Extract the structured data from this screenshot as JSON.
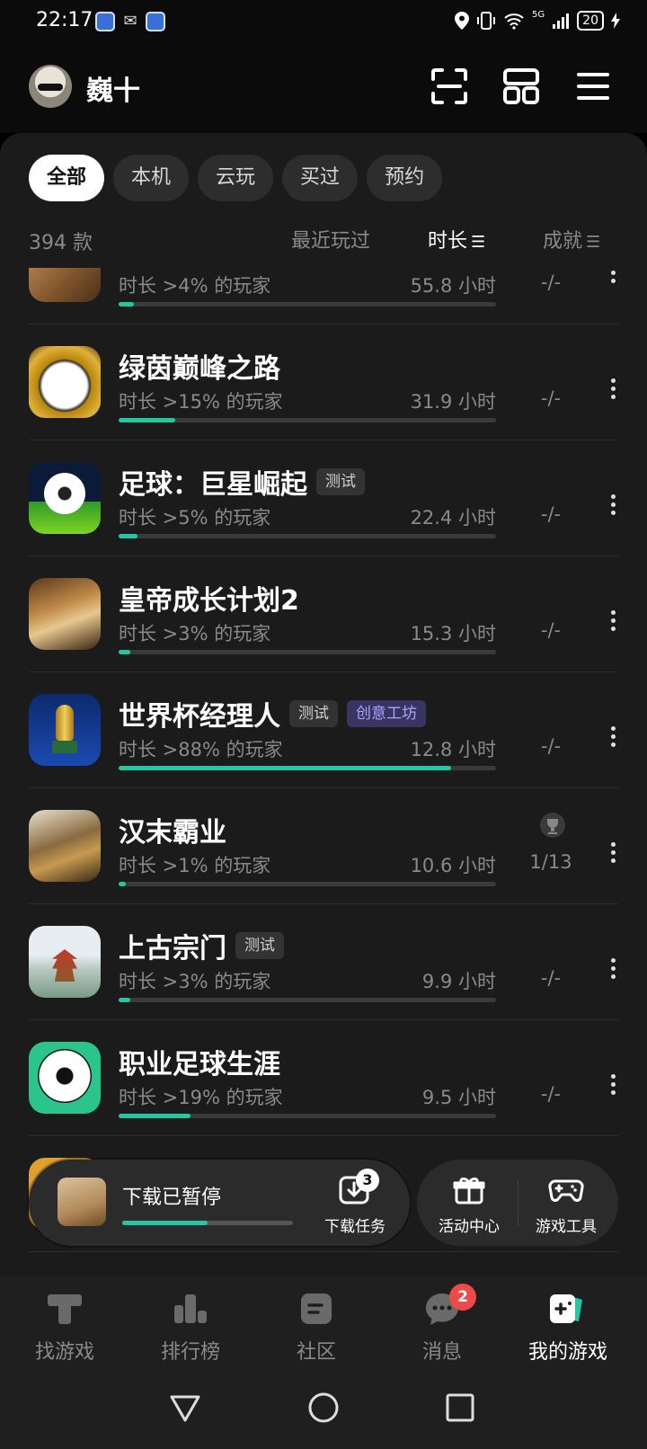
{
  "status_bar": {
    "time": "22:17",
    "network": "5G",
    "battery": "20"
  },
  "header": {
    "username": "巍十"
  },
  "tabs": [
    {
      "label": "全部",
      "active": true
    },
    {
      "label": "本机",
      "active": false
    },
    {
      "label": "云玩",
      "active": false
    },
    {
      "label": "买过",
      "active": false
    },
    {
      "label": "预约",
      "active": false
    }
  ],
  "sortbar": {
    "count": "394 款",
    "recent": "最近玩过",
    "duration": "时长",
    "achievement": "成就"
  },
  "games": [
    {
      "name": "",
      "badges": [],
      "percentile": "时长 >4% 的玩家",
      "hours": "55.8 小时",
      "progress": 0.04,
      "achievement": "-/-",
      "icon": "bronze-mask-icon"
    },
    {
      "name": "绿茵巅峰之路",
      "badges": [],
      "percentile": "时长 >15% 的玩家",
      "hours": "31.9 小时",
      "progress": 0.15,
      "achievement": "-/-",
      "icon": "gold-football-icon"
    },
    {
      "name": "足球：巨星崛起",
      "badges": [
        {
          "text": "测试",
          "style": "gray"
        }
      ],
      "percentile": "时长 >5% 的玩家",
      "hours": "22.4 小时",
      "progress": 0.05,
      "achievement": "-/-",
      "icon": "football-pitch-icon"
    },
    {
      "name": "皇帝成长计划2",
      "badges": [],
      "percentile": "时长 >3% 的玩家",
      "hours": "15.3 小时",
      "progress": 0.03,
      "achievement": "-/-",
      "icon": "emperor-portrait-icon"
    },
    {
      "name": "世界杯经理人",
      "badges": [
        {
          "text": "测试",
          "style": "gray"
        },
        {
          "text": "创意工坊",
          "style": "purple"
        }
      ],
      "percentile": "时长 >88% 的玩家",
      "hours": "12.8 小时",
      "progress": 0.88,
      "achievement": "-/-",
      "icon": "world-cup-trophy-icon"
    },
    {
      "name": "汉末霸业",
      "badges": [],
      "percentile": "时长 >1% 的玩家",
      "hours": "10.6 小时",
      "progress": 0.01,
      "achievement": "1/13",
      "has_trophy": true,
      "icon": "warlord-portrait-icon"
    },
    {
      "name": "上古宗门",
      "badges": [
        {
          "text": "测试",
          "style": "gray"
        }
      ],
      "percentile": "时长 >3% 的玩家",
      "hours": "9.9 小时",
      "progress": 0.03,
      "achievement": "-/-",
      "icon": "pagoda-landscape-icon"
    },
    {
      "name": "职业足球生涯",
      "badges": [],
      "percentile": "时长 >19% 的玩家",
      "hours": "9.5 小时",
      "progress": 0.19,
      "achievement": "-/-",
      "icon": "career-football-icon"
    }
  ],
  "download_bar": {
    "status": "下载已暂停",
    "progress": 0.5,
    "task_label": "下载任务",
    "task_count": "3"
  },
  "tools": {
    "events_label": "活动中心",
    "tools_label": "游戏工具"
  },
  "bottom_nav": [
    {
      "label": "找游戏",
      "icon": "find-game-icon",
      "active": false
    },
    {
      "label": "排行榜",
      "icon": "ranking-icon",
      "active": false
    },
    {
      "label": "社区",
      "icon": "community-icon",
      "active": false
    },
    {
      "label": "消息",
      "icon": "message-icon",
      "active": false,
      "badge": "2"
    },
    {
      "label": "我的游戏",
      "icon": "my-games-icon",
      "active": true
    }
  ],
  "colors": {
    "accent": "#26c6a0",
    "panel": "#1b1b1b",
    "badge_red": "#ef4a4a",
    "badge_purple_text": "#aaa3ff"
  }
}
